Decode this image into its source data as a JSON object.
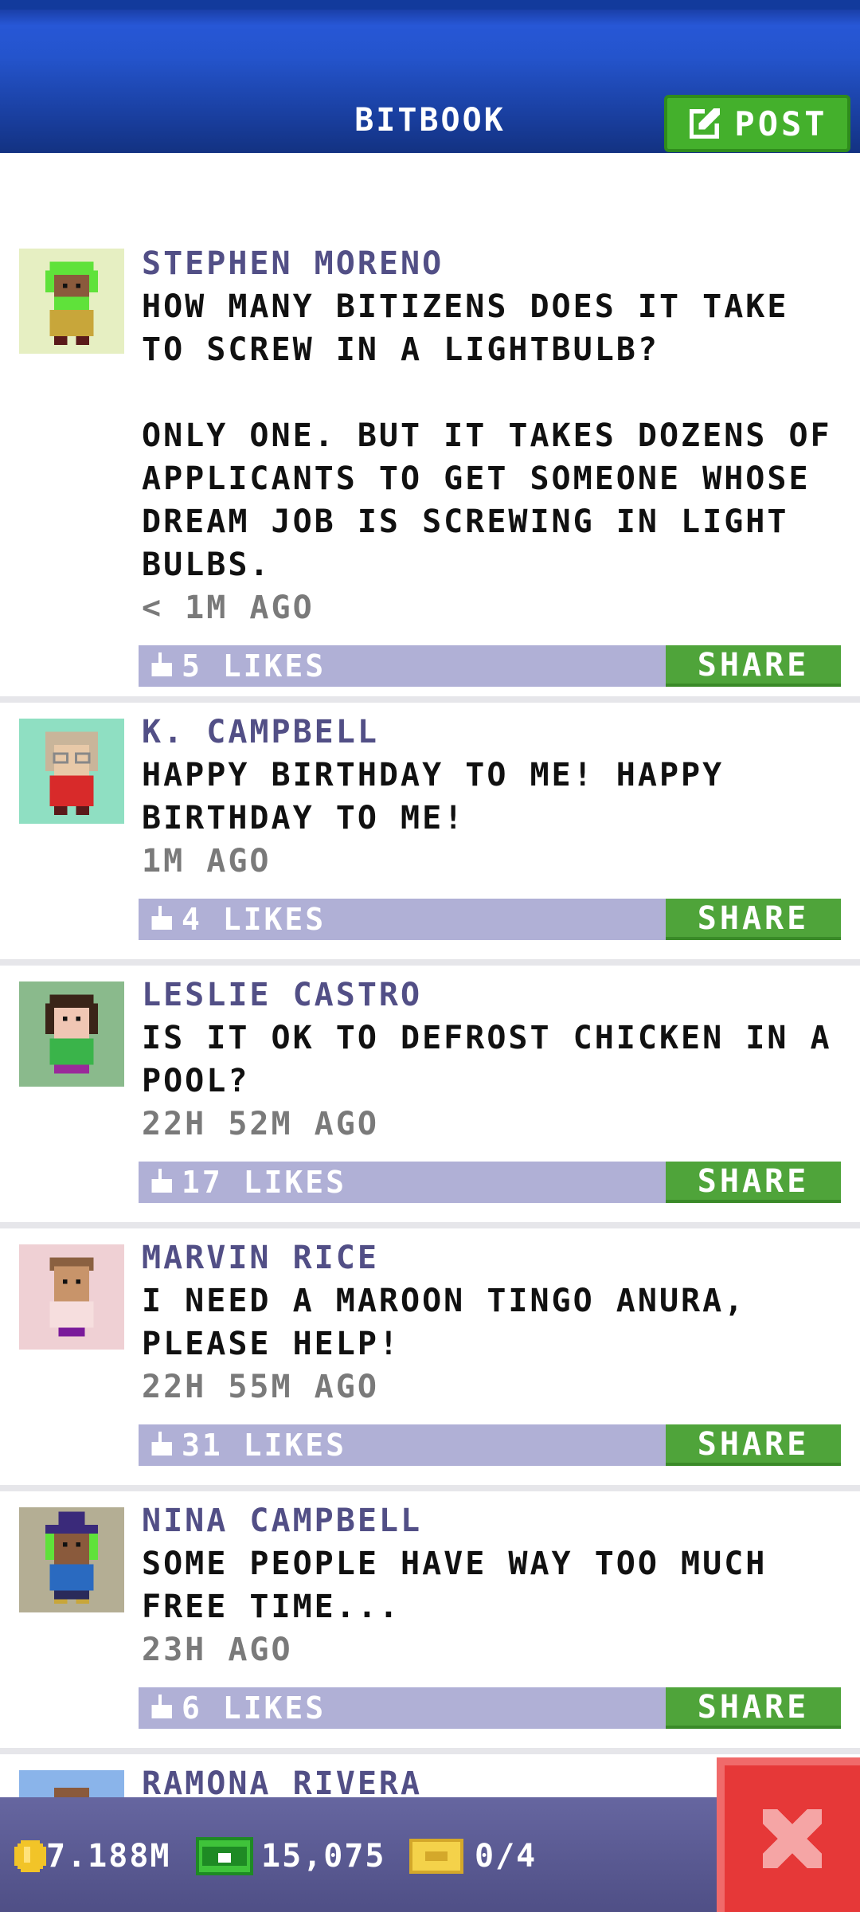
{
  "header": {
    "title": "BITBOOK",
    "post_label": "POST"
  },
  "posts": [
    {
      "author": "STEPHEN MORENO",
      "text": "HOW MANY BITIZENS DOES IT TAKE TO SCREW IN A LIGHTBULB?\n\nONLY ONE. BUT IT TAKES DOZENS OF APPLICANTS TO GET SOMEONE WHOSE DREAM JOB IS SCREWING IN LIGHT BULBS.",
      "time": "< 1M AGO",
      "likes": "5 LIKES",
      "share": "SHARE",
      "avatar_bg": "#e6efc2",
      "hair": "#5fe23a",
      "skin": "#8a5a3c",
      "shirt": "#c8a63a"
    },
    {
      "author": "K. CAMPBELL",
      "text": "HAPPY BIRTHDAY TO ME! HAPPY BIRTHDAY TO ME!",
      "time": "1M AGO",
      "likes": "4 LIKES",
      "share": "SHARE",
      "avatar_bg": "#8fdfc2",
      "hair": "#c9b59a",
      "skin": "#e8c9a8",
      "shirt": "#d82a2a"
    },
    {
      "author": "LESLIE CASTRO",
      "text": "IS IT OK TO DEFROST CHICKEN IN A POOL?",
      "time": "22H 52M AGO",
      "likes": "17 LIKES",
      "share": "SHARE",
      "avatar_bg": "#8aba8c",
      "hair": "#3a2418",
      "skin": "#f0c6b4",
      "shirt": "#3ab44a"
    },
    {
      "author": "MARVIN RICE",
      "text": "I NEED A MAROON TINGO ANURA, PLEASE HELP!",
      "time": "22H 55M AGO",
      "likes": "31 LIKES",
      "share": "SHARE",
      "avatar_bg": "#efd0d4",
      "hair": "#8a6040",
      "skin": "#c8946a",
      "shirt": "#f6dede"
    },
    {
      "author": "NINA CAMPBELL",
      "text": "SOME PEOPLE HAVE WAY TOO MUCH FREE TIME...",
      "time": "23H AGO",
      "likes": "6 LIKES",
      "share": "SHARE",
      "avatar_bg": "#b4ae94",
      "hair": "#3a2a7a",
      "skin": "#8a5a3c",
      "shirt": "#2a6ac0"
    },
    {
      "author": "RAMONA RIVERA",
      "avatar_bg": "#8ab4ea"
    }
  ],
  "bottom": {
    "coins": "7.188M",
    "bux": "15,075",
    "tickets": "0/4"
  },
  "colors": {
    "accent_green": "#44b02c",
    "header_blue": "#2454cc",
    "likes_bar": "#b0b0d6",
    "close_red": "#e63838"
  }
}
